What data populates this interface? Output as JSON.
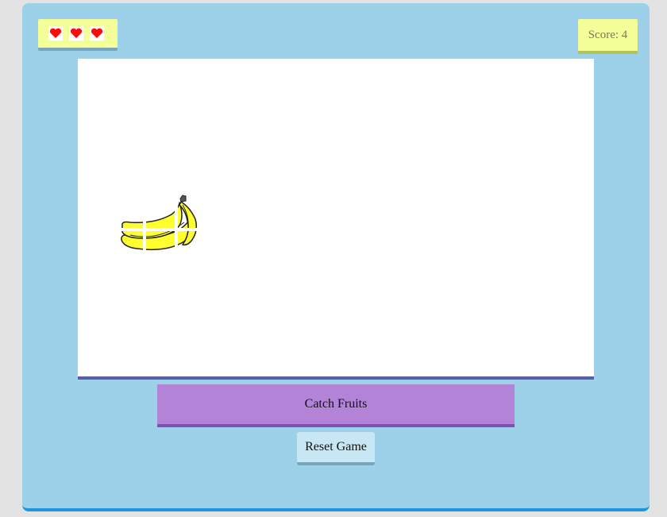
{
  "hud": {
    "lives_count": 3,
    "heart_icon": "heart-icon",
    "heart_color": "#ff0a0a",
    "score_label": "Score:",
    "score_value": "4"
  },
  "board": {
    "fruit": "banana-icon",
    "fruit_color": "#ffff2e"
  },
  "controls": {
    "catch_label": "Catch Fruits",
    "reset_label": "Reset Game"
  },
  "colors": {
    "frame": "#9dd1e9",
    "frame_border": "#1a97de",
    "panel": "#f4ff99",
    "catch_bar": "#b383d8",
    "board_border": "#5a5ea8"
  }
}
